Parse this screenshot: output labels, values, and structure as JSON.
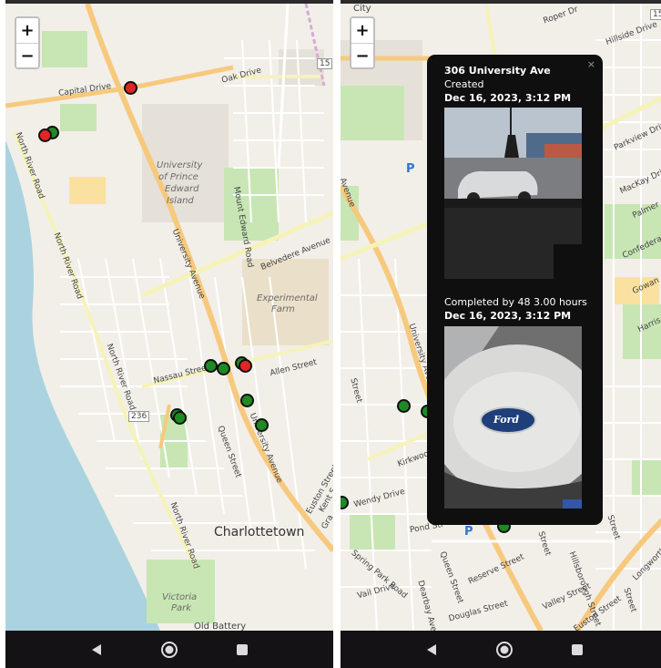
{
  "colors": {
    "map_bg": "#f2efe9",
    "water": "#aad3df",
    "park": "#c8e6b4",
    "road_major": "#f7c97e",
    "road_secondary": "#f5f3b8",
    "marker_green": "#1e8a24",
    "marker_red": "#e02525",
    "popup_bg": "#0f0f0f",
    "navbar_bg": "#141214"
  },
  "zoom_control": {
    "zoom_in": "+",
    "zoom_out": "−"
  },
  "left_map": {
    "labels": {
      "capital_drive": "Capital Drive",
      "oak_drive": "Oak Drive",
      "route_15": "15",
      "university_line1": "University",
      "university_line2": "of Prince",
      "university_line3": "Edward",
      "university_line4": "Island",
      "mount_edward_road": "Mount Edward Road",
      "north_river_road_1": "North River Road",
      "north_river_road_2": "North River Road",
      "north_river_road_3": "North River Road",
      "north_river_road_4": "North River Road",
      "university_avenue": "University Avenue",
      "belvedere_avenue": "Belvedere Avenue",
      "experimental_line1": "Experimental",
      "experimental_line2": "Farm",
      "nassau_street": "Nassau Street",
      "allen_street": "Allen Street",
      "route_236": "236",
      "queen_street": "Queen Street",
      "university_avenue_2": "University Avenue",
      "euston_street": "Euston Street",
      "charlottetown": "Charlottetown",
      "victoria_park_line1": "Victoria",
      "victoria_park_line2": "Park",
      "old_battery": "Old Battery",
      "kent": "Kent S",
      "grafton": "Gra"
    }
  },
  "right_map": {
    "labels": {
      "city": "City",
      "route_15": "15",
      "roper": "Roper Dr",
      "hillside": "Hillside Drive",
      "parkview": "Parkview Drive",
      "mackay": "MacKay Driv",
      "palmer": "Palmer",
      "confederation": "Confederat",
      "gowan": "Gowan",
      "harris": "Harris",
      "university_avenue": "University Avenue",
      "avenue": "Avenue",
      "street": "Street",
      "kirkwood": "Kirkwood",
      "wendy": "Wendy Drive",
      "pond": "Pond Str",
      "spring_park": "Spring Park Road",
      "queen_street": "Queen Street",
      "reserve": "Reserve Street",
      "vail": "Vail Drive",
      "douglas": "Douglas Street",
      "dearbay": "Dearbay Avenue",
      "euston": "Euston Street",
      "longworth": "Longworth Av",
      "valley": "Valley Street",
      "hillsborough": "Hillsborough Street",
      "street_2": "Street",
      "street_3": "Street",
      "street_4": "Street"
    }
  },
  "popup": {
    "close": "×",
    "address": "306 University Ave",
    "created_label": "Created",
    "created_time": "Dec 16, 2023, 3:12 PM",
    "completed_label": "Completed by 48 3.00 hours",
    "completed_time": "Dec 16, 2023, 3:12 PM",
    "photo2_logo_text": "Ford"
  }
}
